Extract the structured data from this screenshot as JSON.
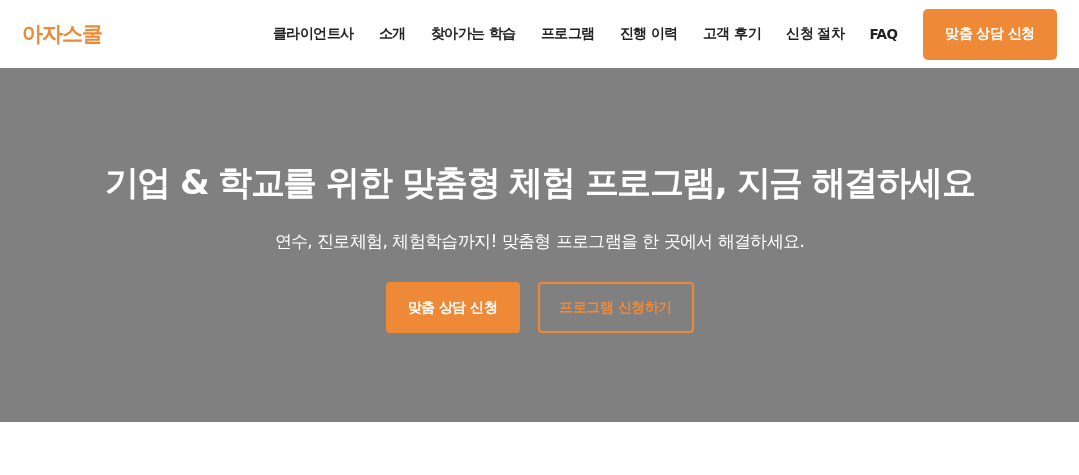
{
  "header": {
    "logo": "아자스쿨",
    "nav": [
      "클라이언트사",
      "소개",
      "찾아가는 학습",
      "프로그램",
      "진행 이력",
      "고객 후기",
      "신청 절차",
      "FAQ"
    ],
    "cta": "맞춤 상담 신청"
  },
  "hero": {
    "title": "기업 & 학교를 위한 맞춤형 체험 프로그램, 지금 해결하세요",
    "subtitle": "연수, 진로체험, 체험학습까지! 맞춤형 프로그램을 한 곳에서 해결하세요.",
    "buttons": [
      {
        "label": "맞춤 상담 신청",
        "kind": "primary"
      },
      {
        "label": "프로그램 신청하기",
        "kind": "outline"
      }
    ]
  }
}
